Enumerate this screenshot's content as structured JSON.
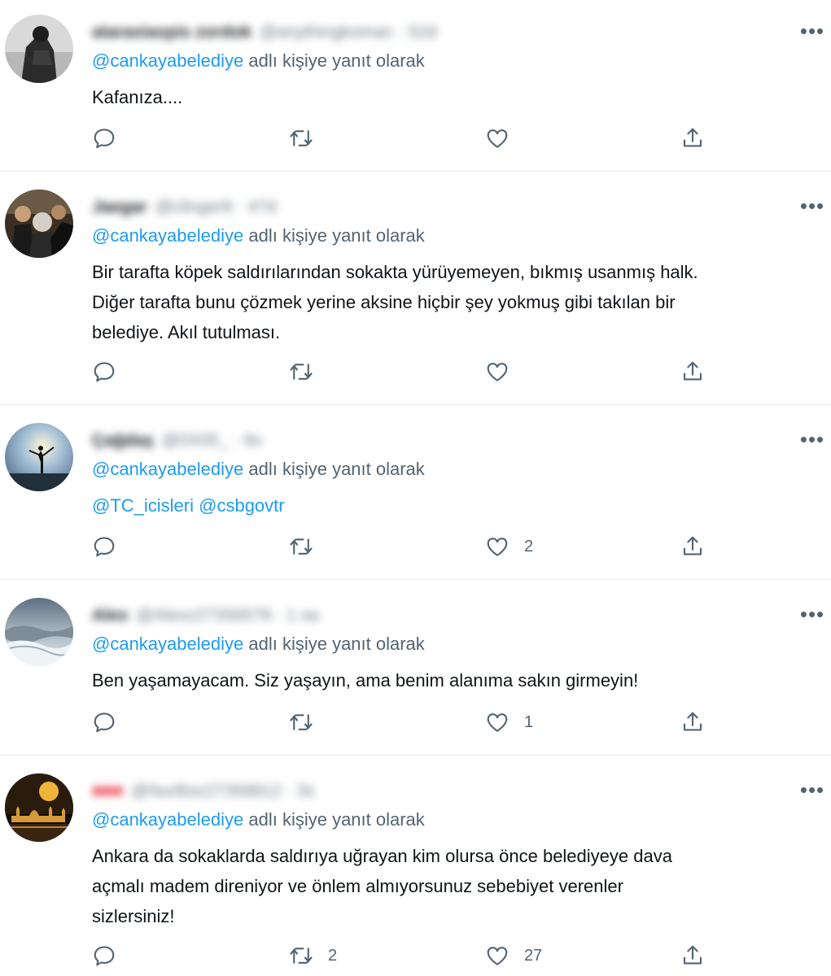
{
  "ui": {
    "more_glyph": "•••",
    "reply_suffix": "adlı kişiye yanıt olarak",
    "icons": [
      "reply-icon",
      "retweet-icon",
      "like-icon",
      "share-icon",
      "more-icon"
    ],
    "colors": {
      "mention": "#1d9bf0",
      "secondary": "#536471",
      "text": "#0f1419",
      "divider": "#e6ecf0",
      "redacted": "#e8333f"
    }
  },
  "tweets": [
    {
      "author_name": "ataraxiaspis zordok",
      "author_handle": "@anythingkoman · 52d",
      "reply_to": "@cankayabelediye",
      "text": "Kafanıza....",
      "reply_count": "",
      "retweet_count": "",
      "like_count": ""
    },
    {
      "author_name": "Jaegar",
      "author_handle": "@clinger8 · 47d",
      "reply_to": "@cankayabelediye",
      "text": "Bir tarafta köpek saldırılarından sokakta yürüyemeyen, bıkmış usanmış halk.\nDiğer tarafta bunu çözmek yerine aksine hiçbir şey yokmuş gibi takılan bir\nbelediye. Akıl tutulması.",
      "reply_count": "",
      "retweet_count": "",
      "like_count": ""
    },
    {
      "author_name": "Çağdaş",
      "author_handle": "@0X05_ · 6s",
      "reply_to": "@cankayabelediye",
      "text": "@TC_icisleri @csbgovtr",
      "reply_count": "",
      "retweet_count": "",
      "like_count": "2"
    },
    {
      "author_name": "Alex",
      "author_handle": "@Alexz27356578 · 1 sa",
      "reply_to": "@cankayabelediye",
      "text": "Ben yaşamayacam. Siz yaşayın, ama benim alanıma sakın girmeyin!",
      "reply_count": "",
      "retweet_count": "",
      "like_count": "1"
    },
    {
      "author_name": "■■■",
      "author_handle": "@NurBoz27358812 · 3s",
      "reply_to": "@cankayabelediye",
      "text": "Ankara da sokaklarda saldırıya uğrayan kim olursa önce belediyeye dava\naçmalı madem direniyor ve önlem almıyorsunuz sebebiyet verenler\nsizlersiniz!",
      "reply_count": "",
      "retweet_count": "2",
      "like_count": "27"
    }
  ]
}
